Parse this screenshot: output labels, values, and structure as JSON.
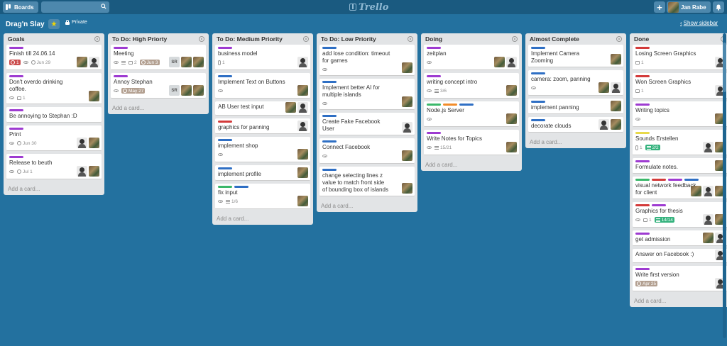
{
  "header": {
    "boards_label": "Boards",
    "search_value": "",
    "logo_text": "Trello",
    "add_label": "+",
    "user_name": "Jan Rabe"
  },
  "board": {
    "title": "Drag'n Slay",
    "visibility": "Private",
    "show_sidebar": "Show sidebar"
  },
  "colors": {
    "purple": "#9e3bd1",
    "blue": "#2f6fc4",
    "green": "#3bb86a",
    "orange": "#f28c2a",
    "red": "#d33a3a",
    "yellow": "#e8d94a"
  },
  "add_card_label": "Add a card...",
  "lists": [
    {
      "title": "Goals",
      "cards": [
        {
          "labels": [
            "purple"
          ],
          "title": "Finish till 24.06.14",
          "badges": [
            {
              "t": "alarm",
              "v": "1"
            },
            {
              "t": "eye"
            },
            {
              "t": "clock",
              "v": "Jun 29"
            }
          ],
          "members": [
            "photo",
            "bw"
          ]
        },
        {
          "labels": [
            "purple"
          ],
          "title": "Don't overdo drinking coffee.",
          "badges": [
            {
              "t": "eye"
            },
            {
              "t": "comment",
              "v": "1"
            }
          ],
          "members": [
            "photo"
          ]
        },
        {
          "labels": [
            "purple"
          ],
          "title": "Be annoying to Stephan :D",
          "badges": [],
          "members": []
        },
        {
          "labels": [
            "purple"
          ],
          "title": "Print",
          "badges": [
            {
              "t": "eye"
            },
            {
              "t": "clock",
              "v": "Jun 30"
            }
          ],
          "members": [
            "bw",
            "photo"
          ]
        },
        {
          "labels": [
            "purple"
          ],
          "title": "Release to beuth",
          "badges": [
            {
              "t": "eye"
            },
            {
              "t": "clock",
              "v": "Jul 1"
            }
          ],
          "members": [
            "bw",
            "photo"
          ]
        }
      ]
    },
    {
      "title": "To Do: High Priorty",
      "cards": [
        {
          "labels": [
            "purple"
          ],
          "title": "Meeting",
          "badges": [
            {
              "t": "eye"
            },
            {
              "t": "desc"
            },
            {
              "t": "comment",
              "v": "2"
            },
            {
              "t": "duepast",
              "v": "Jun 3"
            }
          ],
          "members": [
            "sr",
            "photo",
            "photo"
          ]
        },
        {
          "labels": [
            "purple"
          ],
          "title": "Annoy Stephan",
          "badges": [
            {
              "t": "eye"
            },
            {
              "t": "duepast",
              "v": "May 27"
            }
          ],
          "members": [
            "sr",
            "photo",
            "photo"
          ]
        }
      ]
    },
    {
      "title": "To Do: Medium Priority",
      "cards": [
        {
          "labels": [
            "purple"
          ],
          "title": "business model",
          "badges": [
            {
              "t": "attach",
              "v": "1"
            }
          ],
          "members": [
            "bw"
          ]
        },
        {
          "labels": [
            "blue"
          ],
          "title": "Implement Text on Buttons",
          "badges": [
            {
              "t": "eye"
            }
          ],
          "members": [
            "photo"
          ]
        },
        {
          "labels": [],
          "title": "AB User test input",
          "badges": [],
          "members": [
            "photo",
            "bw"
          ]
        },
        {
          "labels": [
            "red"
          ],
          "title": "graphics for panning",
          "badges": [],
          "members": [
            "bw"
          ]
        },
        {
          "labels": [
            "blue"
          ],
          "title": "implement shop",
          "badges": [
            {
              "t": "eye"
            }
          ],
          "members": [
            "photo"
          ]
        },
        {
          "labels": [
            "blue"
          ],
          "title": "implement profile",
          "badges": [],
          "members": [
            "photo"
          ]
        },
        {
          "labels": [
            "green",
            "blue"
          ],
          "title": "fix input",
          "badges": [
            {
              "t": "eye"
            },
            {
              "t": "check",
              "v": "1/6"
            }
          ],
          "members": [
            "photo"
          ]
        }
      ]
    },
    {
      "title": "To Do: Low Priority",
      "cards": [
        {
          "labels": [
            "blue"
          ],
          "title": "add lose condition: timeout for games",
          "badges": [
            {
              "t": "eye"
            }
          ],
          "members": [
            "photo"
          ]
        },
        {
          "labels": [
            "blue"
          ],
          "title": "Implement better AI for multiple islands",
          "badges": [
            {
              "t": "eye"
            }
          ],
          "members": [
            "photo"
          ]
        },
        {
          "labels": [
            "blue"
          ],
          "title": "Create Fake Facebook User",
          "badges": [],
          "members": [
            "bw"
          ]
        },
        {
          "labels": [
            "blue"
          ],
          "title": "Connect Facebook",
          "badges": [
            {
              "t": "eye"
            }
          ],
          "members": [
            "photo"
          ]
        },
        {
          "labels": [
            "blue"
          ],
          "title": "change selecting lines z value to match front side of bounding box of islands",
          "badges": [],
          "members": [
            "photo"
          ]
        }
      ]
    },
    {
      "title": "Doing",
      "cards": [
        {
          "labels": [
            "purple"
          ],
          "title": "zeitplan",
          "badges": [
            {
              "t": "eye"
            }
          ],
          "members": [
            "photo",
            "bw"
          ]
        },
        {
          "labels": [
            "purple"
          ],
          "title": "writing concept intro",
          "badges": [
            {
              "t": "eye"
            },
            {
              "t": "check",
              "v": "3/6"
            }
          ],
          "members": [
            "photo"
          ]
        },
        {
          "labels": [
            "green",
            "orange",
            "blue"
          ],
          "title": "Node.js Server",
          "badges": [
            {
              "t": "eye"
            }
          ],
          "members": [
            "photo"
          ]
        },
        {
          "labels": [
            "purple"
          ],
          "title": "Write Notes for Topics",
          "badges": [
            {
              "t": "eye"
            },
            {
              "t": "check",
              "v": "15/21"
            }
          ],
          "members": [
            "photo"
          ]
        }
      ]
    },
    {
      "title": "Almost Complete",
      "cards": [
        {
          "labels": [
            "blue"
          ],
          "title": "Implement Camera Zooming",
          "badges": [],
          "members": [
            "photo"
          ]
        },
        {
          "labels": [
            "blue"
          ],
          "title": "camera: zoom, panning",
          "badges": [
            {
              "t": "eye"
            }
          ],
          "members": [
            "photo",
            "bw"
          ]
        },
        {
          "labels": [
            "blue"
          ],
          "title": "implement panning",
          "badges": [],
          "members": [
            "photo"
          ]
        },
        {
          "labels": [
            "blue"
          ],
          "title": "decorate clouds",
          "badges": [],
          "members": [
            "bw",
            "photo"
          ]
        }
      ]
    },
    {
      "title": "Done",
      "cards": [
        {
          "labels": [
            "red"
          ],
          "title": "Losing Screen Graphics",
          "badges": [
            {
              "t": "comment",
              "v": "1"
            }
          ],
          "members": [
            "bw"
          ]
        },
        {
          "labels": [
            "red"
          ],
          "title": "Won Screen Graphics",
          "badges": [
            {
              "t": "comment",
              "v": "1"
            }
          ],
          "members": [
            "bw"
          ]
        },
        {
          "labels": [
            "purple"
          ],
          "title": "Writing topics",
          "badges": [
            {
              "t": "eye"
            }
          ],
          "members": [
            "photo"
          ]
        },
        {
          "labels": [
            "yellow"
          ],
          "title": "Sounds Erstellen",
          "badges": [
            {
              "t": "attach",
              "v": "1"
            },
            {
              "t": "checkdone",
              "v": "2/2"
            }
          ],
          "members": [
            "bw",
            "photo"
          ]
        },
        {
          "labels": [
            "purple"
          ],
          "title": "Formulate notes.",
          "badges": [],
          "members": [
            "photo"
          ]
        },
        {
          "labels": [
            "green",
            "red",
            "purple",
            "blue"
          ],
          "title": "visual network feedback for client",
          "badges": [],
          "members": [
            "photo",
            "bw",
            "photo"
          ]
        },
        {
          "labels": [
            "red",
            "purple"
          ],
          "title": "Graphics for thesis",
          "badges": [
            {
              "t": "eye"
            },
            {
              "t": "comment",
              "v": "1"
            },
            {
              "t": "checkdone",
              "v": "14/14"
            }
          ],
          "members": [
            "bw",
            "photo"
          ]
        },
        {
          "labels": [
            "purple"
          ],
          "title": "get admission",
          "badges": [],
          "members": [
            "photo",
            "bw"
          ]
        },
        {
          "labels": [],
          "title": "Answer on Facebook :)",
          "badges": [],
          "members": [
            "bw"
          ]
        },
        {
          "labels": [
            "purple"
          ],
          "title": "Write first version",
          "badges": [
            {
              "t": "duepast",
              "v": "Apr 25"
            }
          ],
          "members": [
            "bw"
          ]
        }
      ]
    }
  ]
}
